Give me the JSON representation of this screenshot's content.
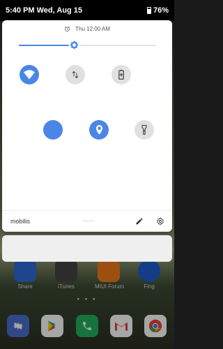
{
  "status_bar": {
    "time_date": "5:40 PM  Wed, Aug 15",
    "battery": "76%"
  },
  "quick_settings": {
    "alarm": "Thu 12:00 AM",
    "brightness": 0.4,
    "tiles": [
      {
        "name": "wifi",
        "state": "on",
        "icon": "wifi-icon"
      },
      {
        "name": "mobile-data",
        "state": "off",
        "icon": "data-arrows-icon"
      },
      {
        "name": "battery-saver",
        "state": "off",
        "icon": "battery-icon"
      },
      {
        "name": "blank",
        "state": "on",
        "icon": "none"
      },
      {
        "name": "location",
        "state": "on",
        "icon": "location-pin-icon"
      },
      {
        "name": "flashlight",
        "state": "off",
        "icon": "flashlight-icon"
      }
    ],
    "carrier": "mobilis",
    "footer_icons": [
      "edit-icon",
      "settings-icon"
    ]
  },
  "home_screen": {
    "apps": [
      {
        "label": "Share",
        "color": "#2f6ad9"
      },
      {
        "label": "iTunes",
        "color": "#444444"
      },
      {
        "label": "MIUI Forum",
        "color": "#f27a1a"
      },
      {
        "label": "Fing",
        "color": "#1f5fd1"
      }
    ],
    "dock": [
      {
        "name": "settings",
        "color": "#4a6fd1"
      },
      {
        "name": "play-store",
        "color": "#ffffff"
      },
      {
        "name": "phone",
        "color": "#21b35b"
      },
      {
        "name": "gmail",
        "color": "#ffffff"
      },
      {
        "name": "chrome",
        "color": "#ffffff"
      }
    ]
  }
}
